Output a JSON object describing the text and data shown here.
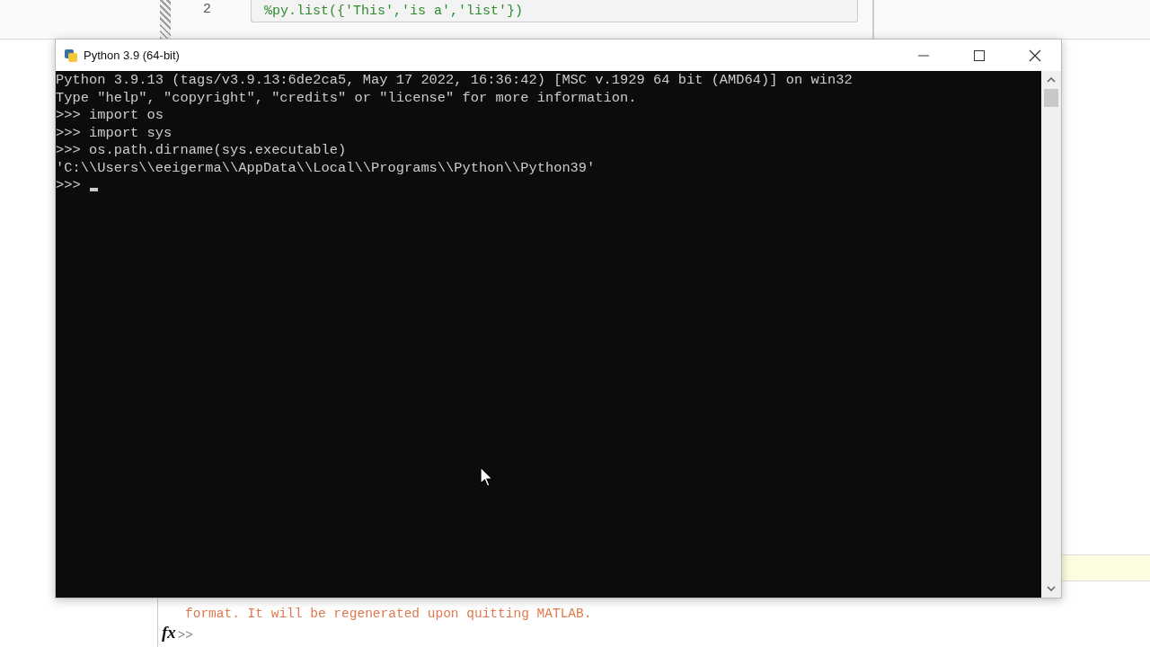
{
  "editor": {
    "line_number": "2",
    "code": "%py.list({'This','is a','list'})"
  },
  "console_window": {
    "title": "Python 3.9 (64-bit)",
    "lines": [
      "Python 3.9.13 (tags/v3.9.13:6de2ca5, May 17 2022, 16:36:42) [MSC v.1929 64 bit (AMD64)] on win32",
      "Type \"help\", \"copyright\", \"credits\" or \"license\" for more information.",
      ">>> import os",
      ">>> import sys",
      ">>> os.path.dirname(sys.executable)",
      "'C:\\\\Users\\\\eeigerma\\\\AppData\\\\Local\\\\Programs\\\\Python\\\\Python39'",
      ">>>"
    ]
  },
  "command_window": {
    "lines": [
      "format. It will be regenerated upon quitting MATLAB."
    ],
    "fx": "fx",
    "prompt": ">>"
  }
}
